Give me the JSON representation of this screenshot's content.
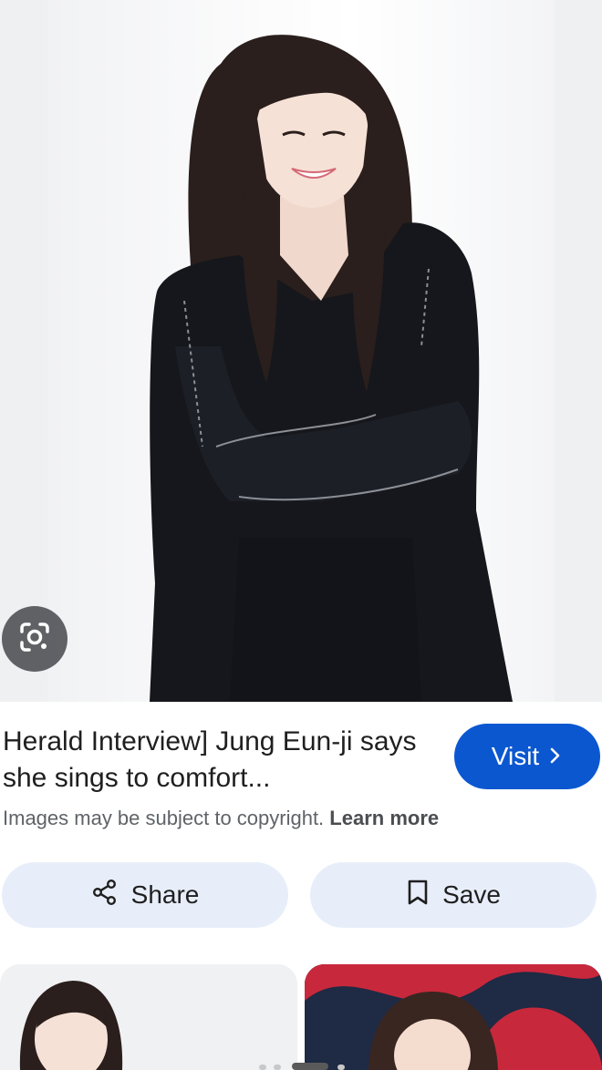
{
  "result": {
    "title": "Herald Interview] Jung Eun-ji says she sings to comfort...",
    "visit_label": "Visit",
    "copyright_text": "Images may be subject to copyright.",
    "learn_more_label": "Learn more"
  },
  "actions": {
    "share_label": "Share",
    "save_label": "Save"
  },
  "colors": {
    "accent": "#0b57d0",
    "pill_background": "#e8eef9",
    "text_primary": "#1f1f1f",
    "text_secondary": "#5f6368"
  },
  "icons": {
    "lens": "google-lens-icon",
    "visit": "chevron-right-icon",
    "share": "share-icon",
    "save": "bookmark-icon"
  }
}
